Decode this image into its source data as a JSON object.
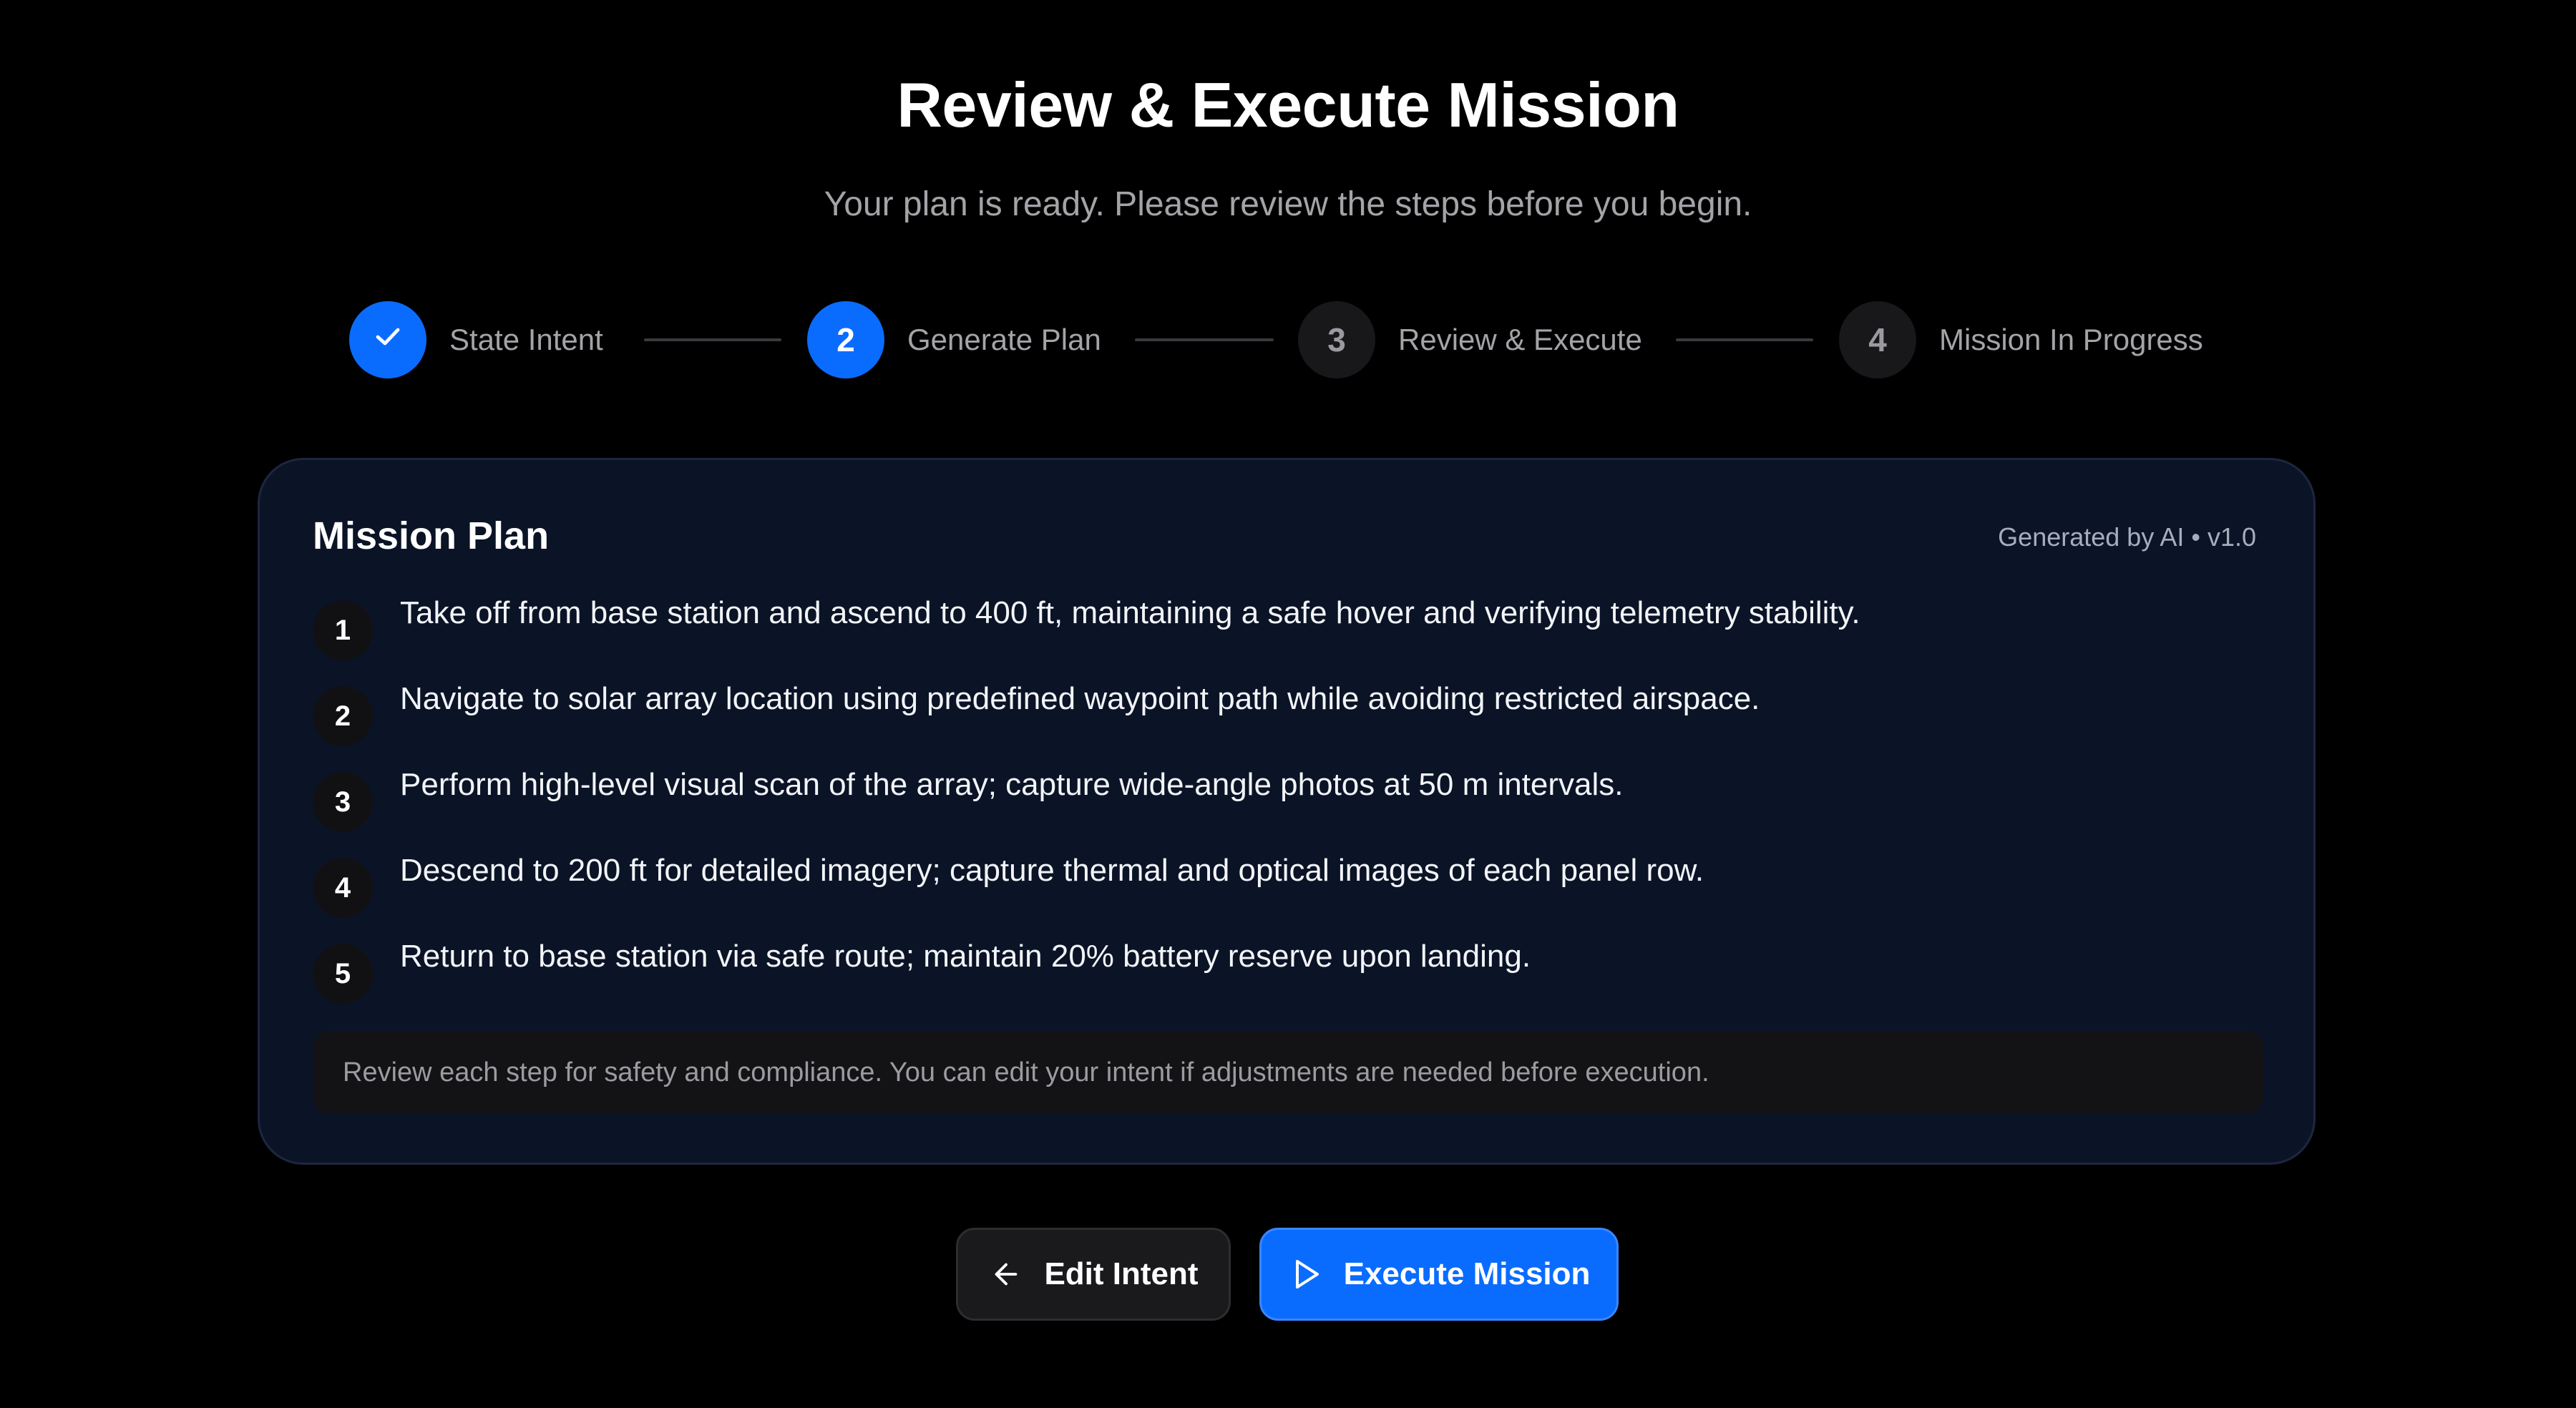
{
  "header": {
    "title": "Review & Execute Mission",
    "subtitle": "Your plan is ready. Please review the steps before you begin."
  },
  "stepper": {
    "steps": [
      {
        "number": "1",
        "label": "State Intent",
        "status": "completed",
        "icon": "check-icon"
      },
      {
        "number": "2",
        "label": "Generate Plan",
        "status": "active"
      },
      {
        "number": "3",
        "label": "Review & Execute",
        "status": "pending"
      },
      {
        "number": "4",
        "label": "Mission In Progress",
        "status": "pending"
      }
    ]
  },
  "plan": {
    "title": "Mission Plan",
    "meta": "Generated by AI • v1.0",
    "steps": [
      {
        "number": "1",
        "text": "Take off from base station and ascend to 400 ft, maintaining a safe hover and verifying telemetry stability."
      },
      {
        "number": "2",
        "text": "Navigate to solar array location using predefined waypoint path while avoiding restricted airspace."
      },
      {
        "number": "3",
        "text": "Perform high-level visual scan of the array; capture wide-angle photos at 50 m intervals."
      },
      {
        "number": "4",
        "text": "Descend to 200 ft for detailed imagery; capture thermal and optical images of each panel row."
      },
      {
        "number": "5",
        "text": "Return to base station via safe route; maintain 20% battery reserve upon landing."
      }
    ],
    "note": "Review each step for safety and compliance. You can edit your intent if adjustments are needed before execution."
  },
  "actions": {
    "edit_label": "Edit Intent",
    "edit_icon": "arrow-left-icon",
    "execute_label": "Execute Mission",
    "execute_icon": "play-icon"
  },
  "colors": {
    "accent": "#0a6cff",
    "card_background": "#0b1426",
    "page_background": "#000000"
  }
}
